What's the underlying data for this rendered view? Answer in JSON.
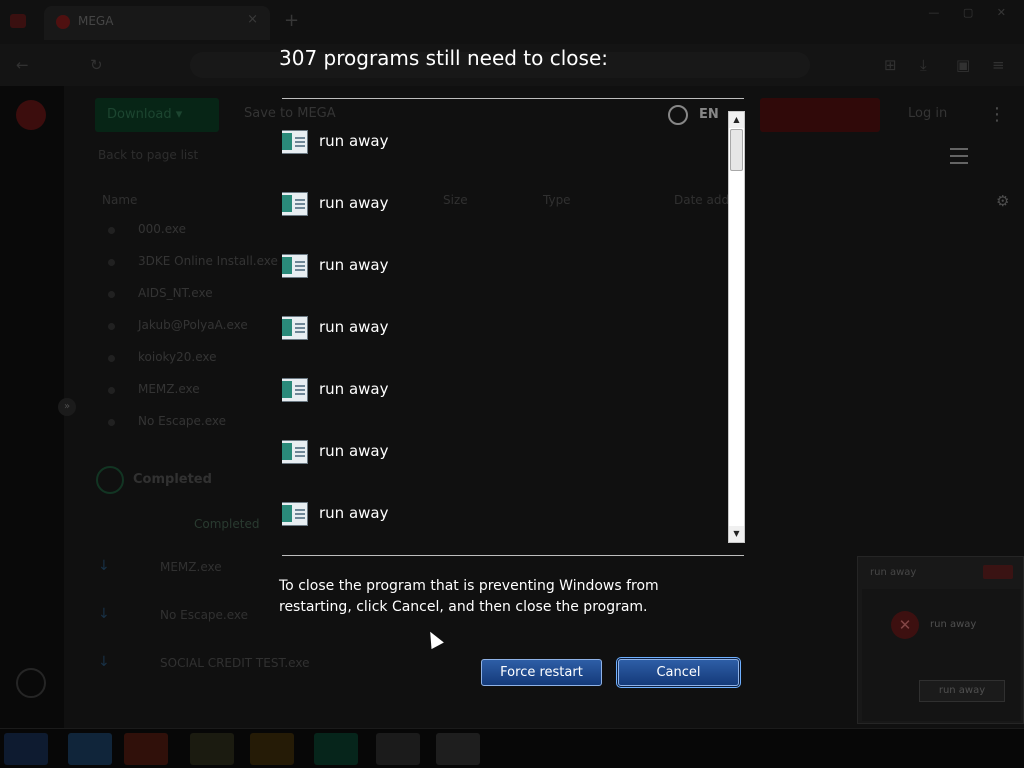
{
  "browser": {
    "tab_title": "MEGA",
    "tab_close": "×",
    "new_tab": "+"
  },
  "mega": {
    "download_label": "Download ▾",
    "save_label": "Save to MEGA",
    "lang": "EN",
    "login_label": "Log in",
    "crumb": "Back to page list",
    "columns": [
      "Name",
      "Size",
      "Type",
      "Date added"
    ],
    "files": [
      {
        "name": "000.exe",
        "size": "",
        "type": "",
        "date": ""
      },
      {
        "name": "3DKE Online Install.exe",
        "size": "",
        "type": "",
        "date": ""
      },
      {
        "name": "AIDS_NT.exe",
        "size": "",
        "type": "",
        "date": ""
      },
      {
        "name": "Jakub@PolyaA.exe",
        "size": "",
        "type": "",
        "date": ""
      },
      {
        "name": "koioky20.exe",
        "size": "",
        "type": "",
        "date": ""
      },
      {
        "name": "MEMZ.exe",
        "size": "",
        "type": "",
        "date": ""
      },
      {
        "name": "No Escape.exe",
        "size": "",
        "type": "",
        "date": ""
      }
    ],
    "completed_label": "Completed",
    "completed_small": "Completed",
    "transfers": [
      "MEMZ.exe",
      "No Escape.exe",
      "SOCIAL CREDIT TEST.exe"
    ]
  },
  "bg_error": {
    "title": "run away",
    "message": "run away",
    "button": "run away"
  },
  "dialog": {
    "title": "307 programs still need to close:",
    "programs": [
      "run away",
      "run away",
      "run away",
      "run away",
      "run away",
      "run away",
      "run away"
    ],
    "help_text": "To close the program that is preventing Windows from restarting, click Cancel, and then close the program.",
    "force_restart_label": "Force restart",
    "cancel_label": "Cancel"
  },
  "colors": {
    "button_gradient_top": "#2e5ea6",
    "button_gradient_bottom": "#143a7a",
    "button_border": "#8fb2e6",
    "overlay_text": "#ffffff"
  },
  "icons": {
    "program": "app-window-icon",
    "error": "error-x-icon",
    "scroll_up": "scroll-up-arrow-icon",
    "scroll_down": "scroll-down-arrow-icon"
  }
}
